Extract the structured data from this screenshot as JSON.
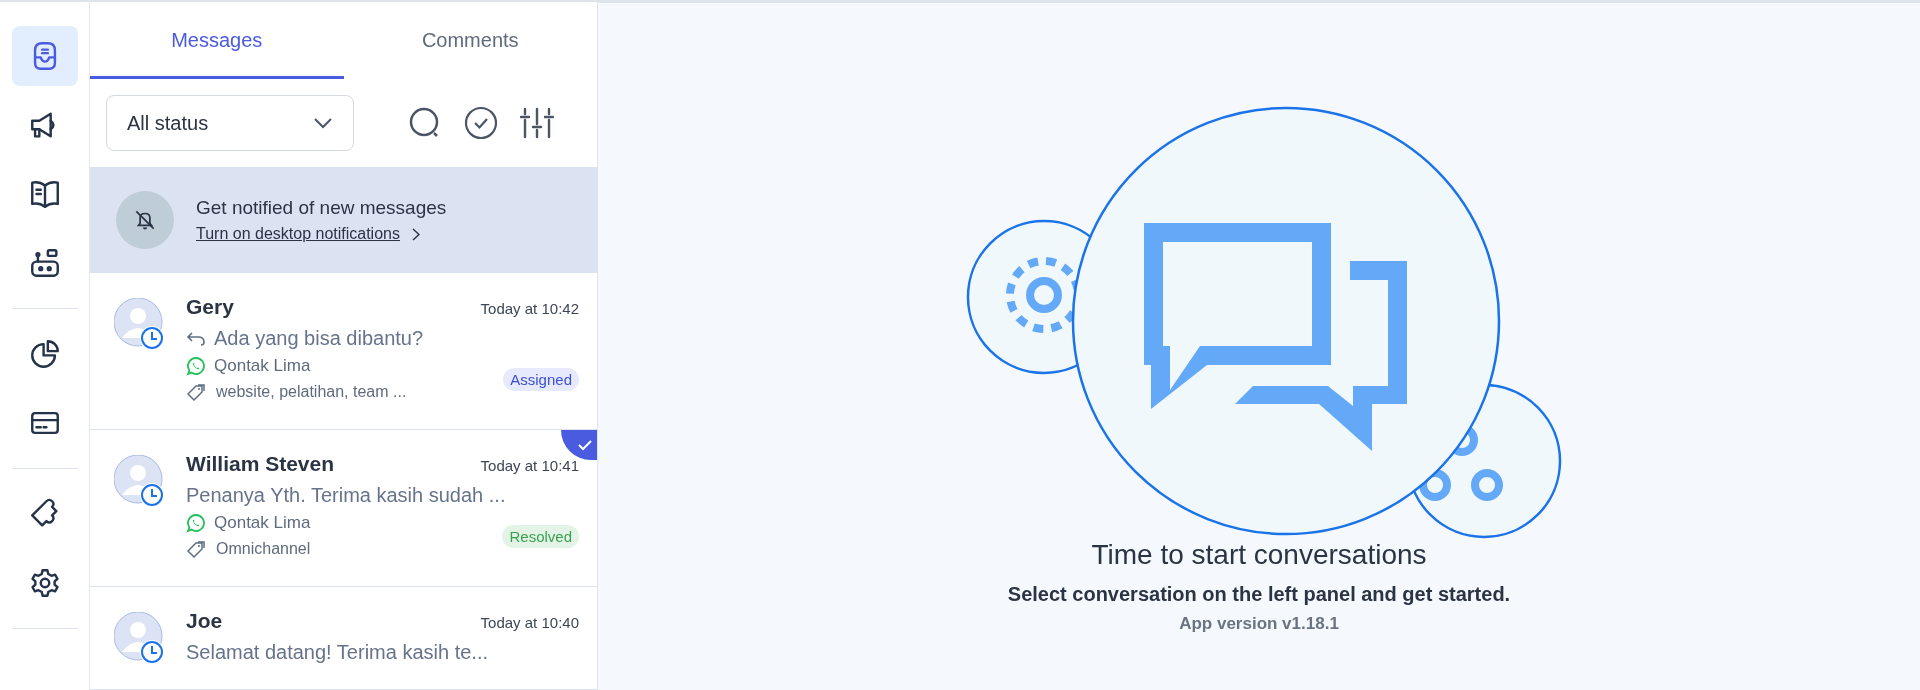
{
  "nav": [
    {
      "kind": "inbox",
      "selected": true
    },
    {
      "kind": "megaphone",
      "selected": false
    },
    {
      "kind": "book",
      "selected": false
    },
    {
      "kind": "robot",
      "selected": false
    },
    {
      "kind": "divider"
    },
    {
      "kind": "chart",
      "selected": false
    },
    {
      "kind": "card",
      "selected": false
    },
    {
      "kind": "divider"
    },
    {
      "kind": "puzzle",
      "selected": false
    },
    {
      "kind": "gear",
      "selected": false
    },
    {
      "kind": "divider"
    }
  ],
  "tabs": [
    {
      "label": "Messages",
      "selected": true
    },
    {
      "label": "Comments",
      "selected": false
    }
  ],
  "filter": {
    "value": "All status"
  },
  "banner": {
    "title": "Get notified of new messages",
    "link": "Turn on desktop notifications"
  },
  "conversations": [
    {
      "name": "Gery",
      "time": "Today at 10:42",
      "replied": true,
      "preview": "Ada yang bisa dibantu?",
      "channel": "Qontak Lima",
      "tags": "website, pelatihan, team ...",
      "status": {
        "kind": "assigned",
        "label": "Assigned"
      },
      "checked": false
    },
    {
      "name": "William Steven",
      "time": "Today at 10:41",
      "replied": false,
      "preview": "Penanya Yth. Terima kasih sudah ...",
      "channel": "Qontak Lima",
      "tags": "Omnichannel",
      "status": {
        "kind": "resolved",
        "label": "Resolved"
      },
      "checked": true
    },
    {
      "name": "Joe",
      "time": "Today at 10:40",
      "replied": false,
      "preview": "Selamat datang! Terima kasih te...",
      "checked": false
    }
  ],
  "empty_state": {
    "title": "Time to start conversations",
    "subtitle": "Select conversation on the left panel and get started.",
    "version": "App version v1.18.1"
  }
}
